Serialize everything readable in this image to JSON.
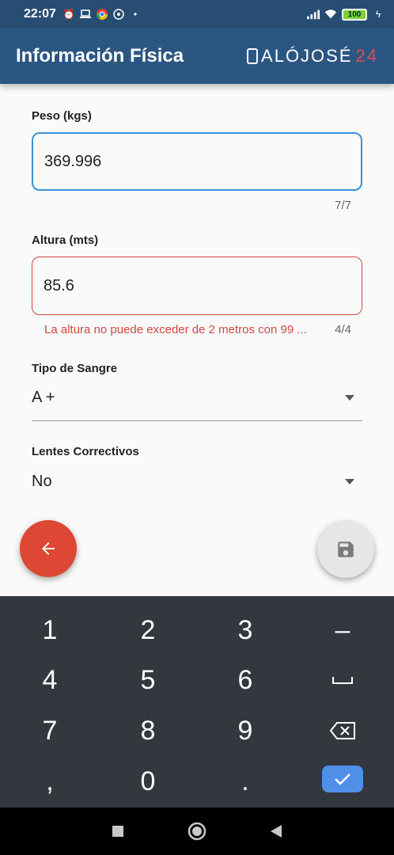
{
  "status_bar": {
    "time": "22:07",
    "battery": "100"
  },
  "app_bar": {
    "title": "Información Física",
    "logo_text": "ALÓJOSÉ",
    "logo_num": "24"
  },
  "form": {
    "peso": {
      "label": "Peso (kgs)",
      "value": "369.996",
      "counter": "7/7"
    },
    "altura": {
      "label": "Altura (mts)",
      "value": "85.6",
      "error": "La altura no puede exceder de 2 metros con 99 ...",
      "counter": "4/4"
    },
    "tipo_sangre": {
      "label": "Tipo de Sangre",
      "value": "A +"
    },
    "lentes": {
      "label": "Lentes Correctivos",
      "value": "No"
    }
  },
  "keyboard": {
    "keys": [
      "1",
      "2",
      "3",
      "–",
      "4",
      "5",
      "6",
      "␣",
      "7",
      "8",
      "9",
      "⌫",
      ",",
      "0",
      ".",
      "✓"
    ]
  },
  "colors": {
    "appbar": "#2c5682",
    "focus": "#3b91d6",
    "error": "#d24646",
    "fab_back": "#dd4733",
    "keyboard": "#33373e",
    "done_key": "#4f8fe8"
  }
}
